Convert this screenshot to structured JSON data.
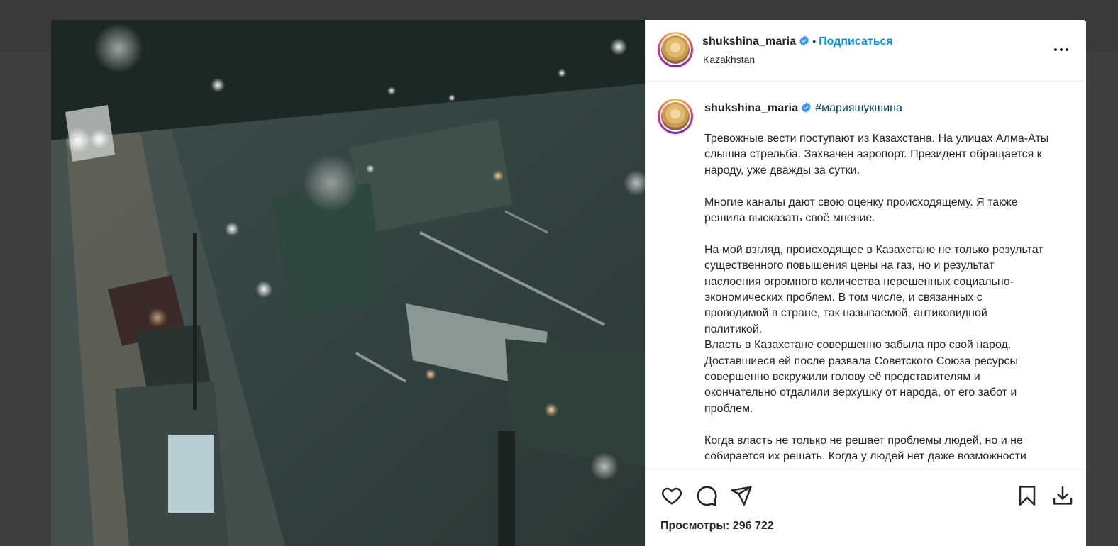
{
  "post": {
    "username": "shukshina_maria",
    "follow_label": "Подписаться",
    "location": "Kazakhstan",
    "hashtag": "#марияшукшина",
    "caption": [
      "Тревожные вести поступают из Казахстана. На улицах Алма-Аты",
      "слышна стрельба. Захвачен аэропорт. Президент обращается к",
      "народу, уже дважды за сутки.",
      "",
      "Многие каналы дают свою оценку происходящему. Я также",
      "решила высказать своё мнение.",
      "",
      "На мой взгляд, происходящее в Казахстане не только результат",
      "существенного повышения цены на газ, но и результат",
      "наслоения огромного количества нерешенных социально-",
      "экономических проблем. В том числе, и связанных с",
      "проводимой в стране, так называемой, антиковидной",
      "политикой.",
      "Власть в Казахстане совершенно забыла про свой народ.",
      "Доставшиеся ей после развала Советского Союза ресурсы",
      "совершенно вскружили голову её представителям и",
      "окончательно отдалили верхушку от народа, от его забот и",
      "проблем.",
      "",
      "Когда власть не только не решает проблемы людей, но и не",
      "собирается их решать. Когда у людей нет даже возможности"
    ],
    "views_label": "Просмотры:",
    "views_count": "296 722"
  },
  "icons": {
    "verified": "verified-badge-icon",
    "more": "more-options-icon",
    "like": "heart-icon",
    "comment": "comment-icon",
    "share": "share-icon",
    "save": "bookmark-icon",
    "download": "download-icon"
  },
  "colors": {
    "follow": "#0095f6",
    "hashtag": "#00376b",
    "verified": "#3897f0"
  }
}
